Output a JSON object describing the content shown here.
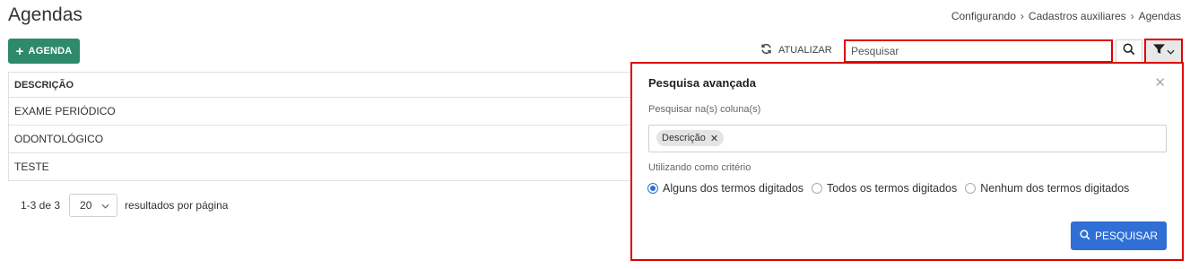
{
  "header": {
    "title": "Agendas",
    "breadcrumb": [
      "Configurando",
      "Cadastros auxiliares",
      "Agendas"
    ]
  },
  "toolbar": {
    "add_label": "AGENDA",
    "refresh_label": "ATUALIZAR",
    "search_placeholder": "Pesquisar"
  },
  "table": {
    "columns": [
      "DESCRIÇÃO"
    ],
    "rows": [
      "EXAME PERIÓDICO",
      "ODONTOLÓGICO",
      "TESTE"
    ]
  },
  "pagination": {
    "range": "1-3 de 3",
    "page_size": "20",
    "per_page_label": "resultados por página"
  },
  "advanced_search": {
    "title": "Pesquisa avançada",
    "columns_label": "Pesquisar na(s) coluna(s)",
    "selected_columns": [
      "Descrição"
    ],
    "criteria_label": "Utilizando como critério",
    "options": [
      "Alguns dos termos digitados",
      "Todos os termos digitados",
      "Nenhum dos termos digitados"
    ],
    "selected_option": "Alguns dos termos digitados",
    "submit_label": "PESQUISAR"
  },
  "colors": {
    "primary": "#2f6fd6",
    "add_button": "#2e8a6a",
    "highlight_border": "#e00000"
  },
  "icons": [
    "plus-icon",
    "refresh-icon",
    "search-icon",
    "filter-icon",
    "chevron-down-icon",
    "close-icon",
    "remove-tag-icon",
    "chevron-right-icon"
  ]
}
